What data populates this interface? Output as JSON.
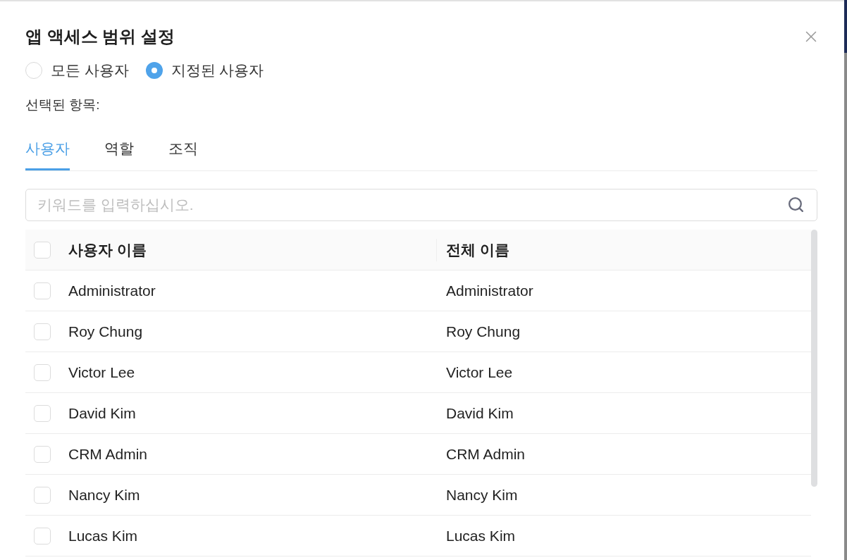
{
  "dialog": {
    "title": "앱 액세스 범위 설정"
  },
  "scope_options": [
    {
      "label": "모든 사용자",
      "selected": false
    },
    {
      "label": "지정된 사용자",
      "selected": true
    }
  ],
  "selected_items_label": "선택된 항목:",
  "tabs": [
    {
      "label": "사용자",
      "selected": true
    },
    {
      "label": "역할",
      "selected": false
    },
    {
      "label": "조직",
      "selected": false
    }
  ],
  "search": {
    "placeholder": "키워드를 입력하십시오."
  },
  "table": {
    "columns": [
      "사용자 이름",
      "전체 이름"
    ],
    "header_checked": false,
    "rows": [
      {
        "checked": false,
        "cells": [
          "Administrator",
          "Administrator"
        ]
      },
      {
        "checked": false,
        "cells": [
          "Roy Chung",
          "Roy Chung"
        ]
      },
      {
        "checked": false,
        "cells": [
          "Victor Lee",
          "Victor Lee"
        ]
      },
      {
        "checked": false,
        "cells": [
          "David Kim",
          "David Kim"
        ]
      },
      {
        "checked": false,
        "cells": [
          "CRM Admin",
          "CRM Admin"
        ]
      },
      {
        "checked": false,
        "cells": [
          "Nancy Kim",
          "Nancy Kim"
        ]
      },
      {
        "checked": false,
        "cells": [
          "Lucas Kim",
          "Lucas Kim"
        ]
      }
    ]
  }
}
